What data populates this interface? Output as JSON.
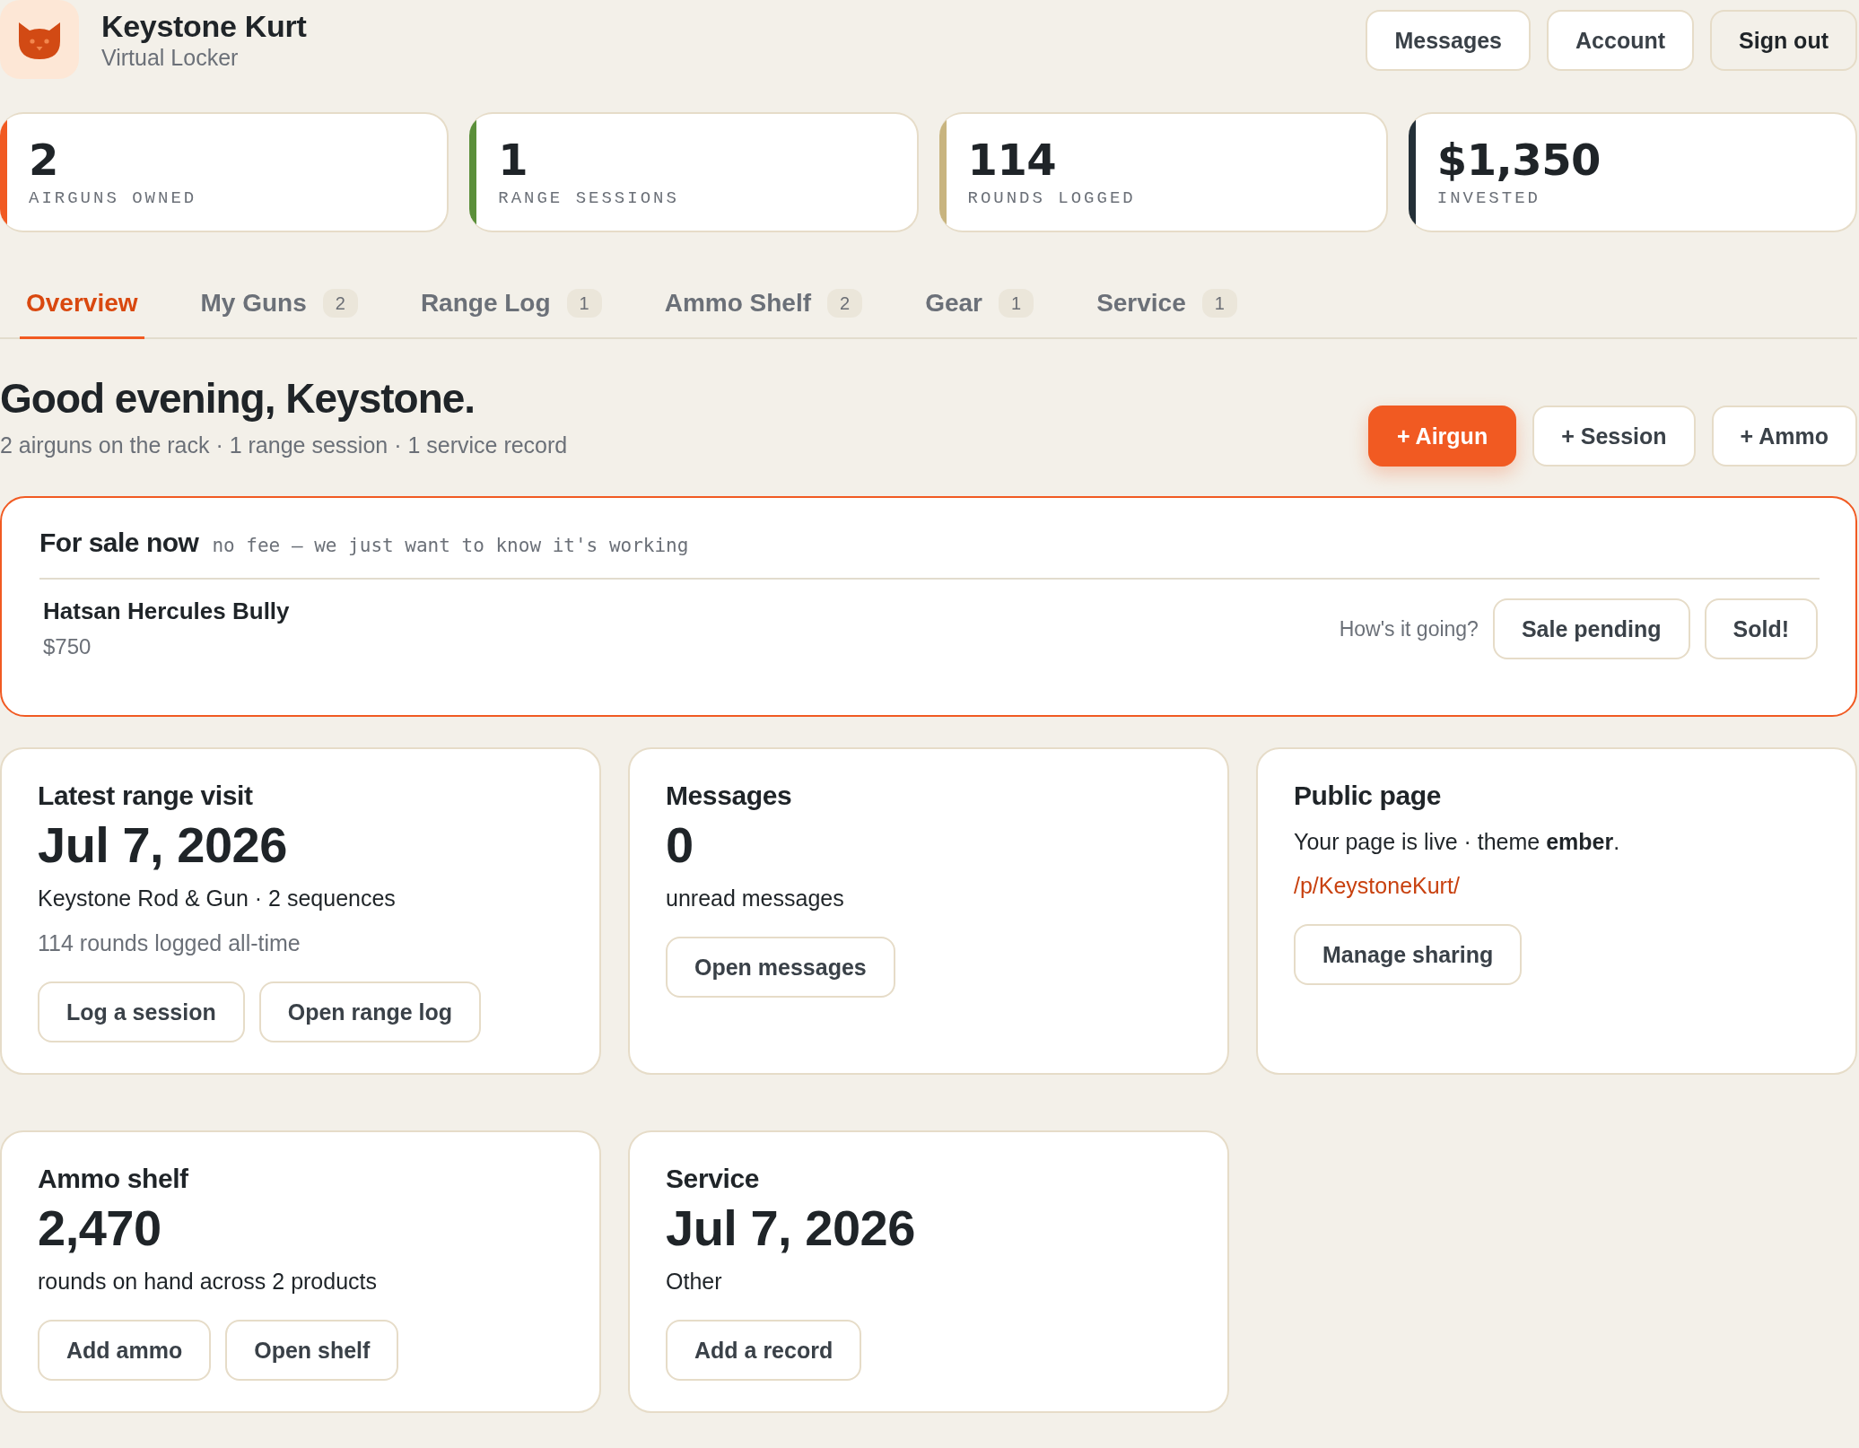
{
  "header": {
    "title": "Keystone Kurt",
    "subtitle": "Virtual Locker",
    "buttons": [
      {
        "label": "Messages",
        "kind": "outline"
      },
      {
        "label": "Account",
        "kind": "outline"
      },
      {
        "label": "Sign out",
        "kind": "ghost"
      }
    ]
  },
  "stats": [
    {
      "value": "2",
      "label": "AIRGUNS OWNED",
      "color": "#f15a22"
    },
    {
      "value": "1",
      "label": "RANGE SESSIONS",
      "color": "#5b8f3a"
    },
    {
      "value": "114",
      "label": "ROUNDS LOGGED",
      "color": "#c8b47f"
    },
    {
      "value": "$1,350",
      "label": "INVESTED",
      "color": "#243038"
    }
  ],
  "tabs": [
    {
      "label": "Overview",
      "selected": true
    },
    {
      "label": "My Guns",
      "count": "2",
      "selected": false
    },
    {
      "label": "Range Log",
      "count": "1",
      "selected": false
    },
    {
      "label": "Ammo Shelf",
      "count": "2",
      "selected": false
    },
    {
      "label": "Gear",
      "count": "1",
      "selected": false
    },
    {
      "label": "Service",
      "count": "1",
      "selected": false
    }
  ],
  "greeting": {
    "title": "Good evening, Keystone.",
    "summary": "2 airguns on the rack · 1 range session · 1 service record",
    "actions": [
      {
        "label": "+ Airgun",
        "kind": "primary"
      },
      {
        "label": "+ Session",
        "kind": "outline"
      },
      {
        "label": "+ Ammo",
        "kind": "outline"
      }
    ]
  },
  "for_sale": {
    "title": "For sale now",
    "note": "no fee — we just want to know it's working",
    "items": [
      {
        "name": "Hatsan Hercules Bully",
        "price": "$750",
        "prompt": "How's it going?",
        "buttons": [
          "Sale pending",
          "Sold!"
        ]
      }
    ]
  },
  "cards": [
    {
      "title": "Latest range visit",
      "value": "Jul 7, 2026",
      "lines": [
        {
          "text": "Keystone Rod & Gun · 2 sequences",
          "kind": "body"
        },
        {
          "text": "114 rounds logged all-time",
          "kind": "muted"
        }
      ],
      "buttons": [
        "Log a session",
        "Open range log"
      ]
    },
    {
      "title": "Messages",
      "value": "0",
      "lines": [
        {
          "text": "unread messages",
          "kind": "body"
        }
      ],
      "buttons": [
        "Open messages"
      ]
    },
    {
      "title": "Public page",
      "lines": [
        {
          "text": "Your page is live · theme **ember**.",
          "kind": "body"
        },
        {
          "text": "/p/KeystoneKurt/",
          "kind": "link"
        }
      ],
      "buttons": [
        "Manage sharing"
      ]
    },
    {
      "title": "Ammo shelf",
      "value": "2,470",
      "lines": [
        {
          "text": "rounds on hand across 2 products",
          "kind": "body"
        }
      ],
      "buttons": [
        "Add ammo",
        "Open shelf"
      ]
    },
    {
      "title": "Service",
      "value": "Jul 7, 2026",
      "lines": [
        {
          "text": "Other",
          "kind": "body"
        }
      ],
      "buttons": [
        "Add a record"
      ]
    }
  ]
}
